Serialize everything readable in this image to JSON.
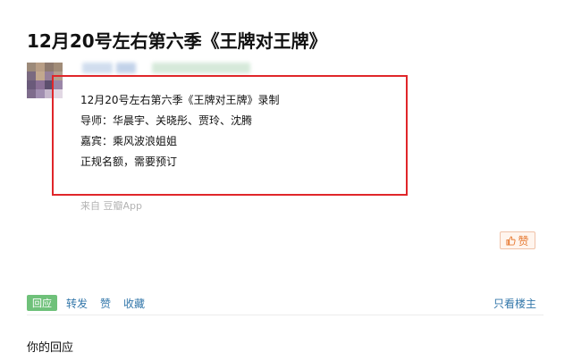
{
  "post": {
    "title": "12月20号左右第六季《王牌对王牌》",
    "lines": [
      "12月20号左右第六季《王牌对王牌》录制",
      "导师：华晨宇、关晓彤、贾玲、沈腾",
      "嘉宾：乘风波浪姐姐",
      "正规名额，需要预订"
    ],
    "source": "来自 豆瓣App"
  },
  "like_button": {
    "label": "赞",
    "icon": "thumb-up-icon",
    "color": "#e67a33"
  },
  "actions": {
    "reply_label": "回应",
    "repost_label": "转发",
    "like_label": "赞",
    "collect_label": "收藏",
    "op_only_label": "只看楼主"
  },
  "reply_section": {
    "label": "你的回应"
  },
  "colors": {
    "highlight_border": "#e0262a",
    "link": "#3377aa",
    "reply_tag": "#6fc17a"
  }
}
